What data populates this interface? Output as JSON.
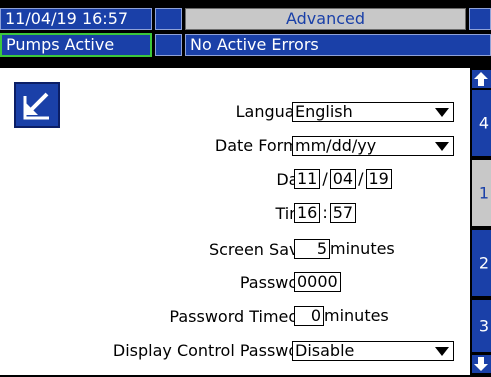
{
  "header": {
    "datetime": "11/04/19 16:57",
    "screen_title": "Advanced",
    "pump_status": "Pumps Active",
    "error_status": "No Active Errors"
  },
  "settings": {
    "language_label": "Language:",
    "language_value": "English",
    "date_format_label": "Date Format:",
    "date_format_value": "mm/dd/yy",
    "date_label": "Date:",
    "date_month": "11",
    "date_day": "04",
    "date_year": "19",
    "date_sep": "/",
    "time_label": "Time:",
    "time_hour": "16",
    "time_minute": "57",
    "time_sep": ":",
    "screen_saver_label": "Screen Saver:",
    "screen_saver_value": "5",
    "screen_saver_unit": "minutes",
    "password_label": "Password:",
    "password_value": "0000",
    "password_timeout_label": "Password Timeout:",
    "password_timeout_value": "0",
    "password_timeout_unit": "minutes",
    "display_control_label": "Display Control Password:",
    "display_control_value": "Disable"
  },
  "tabs": [
    {
      "label": "4"
    },
    {
      "label": "1"
    },
    {
      "label": "2"
    },
    {
      "label": "3"
    }
  ],
  "icons": {
    "back": "back-arrow-icon",
    "scroll_up": "arrow-up-icon",
    "scroll_down": "arrow-down-icon",
    "dropdown": "chevron-down-icon"
  },
  "colors": {
    "accent_blue": "#1a40a8",
    "selected_gray": "#c8c8c8",
    "status_green": "#3cc83c"
  }
}
